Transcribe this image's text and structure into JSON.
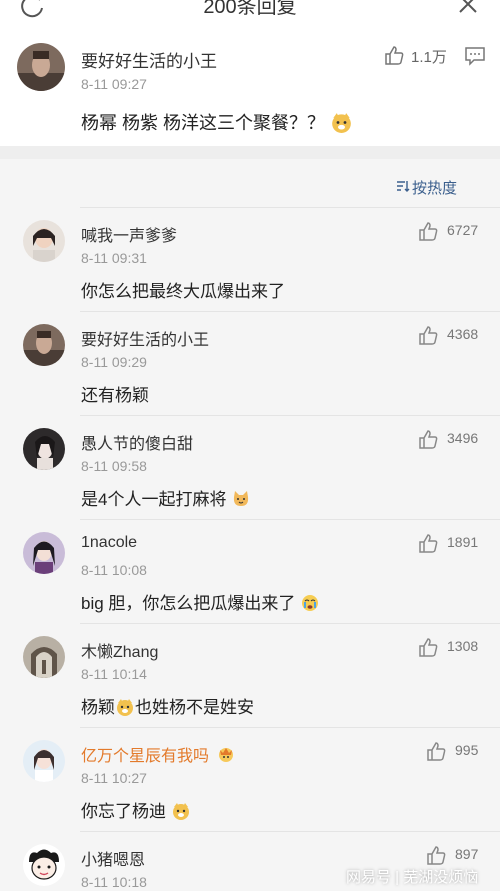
{
  "header": {
    "title": "200条回复",
    "refresh_icon": "refresh-icon",
    "close_icon": "close-icon"
  },
  "main_post": {
    "username": "要好好生活的小王",
    "time": "8-11 09:27",
    "content": "杨幂 杨紫 杨洋这三个聚餐？？",
    "like_count": "1.1万",
    "emoji": "doge-emoji"
  },
  "sort": {
    "label": "按热度",
    "icon": "sort-icon"
  },
  "comments": [
    {
      "username": "喊我一声爹爹",
      "time": "8-11 09:31",
      "content": "你怎么把最终大瓜爆出来了",
      "likes": "6727"
    },
    {
      "username": "要好好生活的小王",
      "time": "8-11 09:29",
      "content": "还有杨颖",
      "likes": "4368"
    },
    {
      "username": "愚人节的傻白甜",
      "time": "8-11 09:58",
      "content": "是4个人一起打麻将",
      "likes": "3496",
      "emoji": "cat-emoji"
    },
    {
      "username": "1nacole",
      "time": "8-11 10:08",
      "content": "big 胆，你怎么把瓜爆出来了",
      "likes": "1891",
      "emoji": "crying-emoji"
    },
    {
      "username": "木懒Zhang",
      "time": "8-11 10:14",
      "content_a": "杨颖",
      "content_b": "也姓杨不是姓安",
      "likes": "1308",
      "emoji": "doge-emoji"
    },
    {
      "username": "亿万个星辰有我吗",
      "time": "8-11 10:27",
      "content": "你忘了杨迪",
      "likes": "995",
      "emoji": "doge-emoji",
      "badge": "crown-badge",
      "name_color": "#e37a2b"
    },
    {
      "username": "小猪嗯恩",
      "time": "8-11 10:18",
      "content": "",
      "likes": "897"
    }
  ],
  "watermark": "网易号 | 芜湖没烦恼",
  "colors": {
    "link_blue": "#3b5f8d",
    "vip_orange": "#e37a2b",
    "band_gray": "#eeeeee",
    "section_bg": "#f5f5f5"
  }
}
